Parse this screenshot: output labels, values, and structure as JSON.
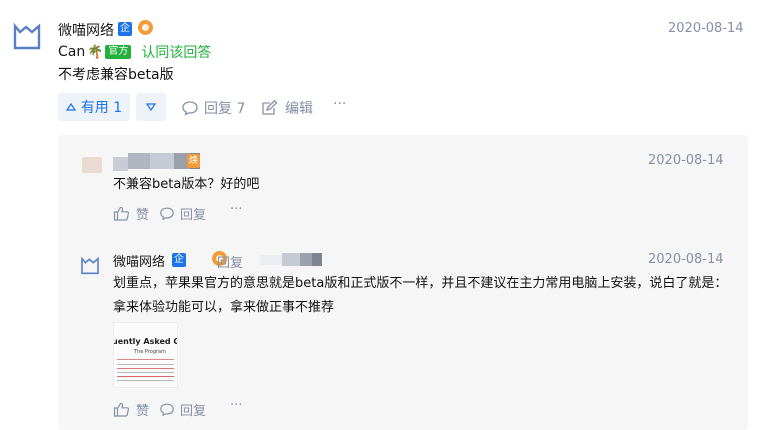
{
  "main_comment": {
    "author": "微喵网络",
    "qi_badge": "企",
    "date": "2020-08-14",
    "endorser_name": "Can",
    "official_tag": "官方",
    "endorse_text": "认同该回答",
    "content": "不考虑兼容beta版",
    "upvote_label": "有用 1",
    "reply_label": "回复 7",
    "edit_label": "编辑",
    "more_label": "···"
  },
  "replies": [
    {
      "date": "2020-08-14",
      "content": "不兼容beta版本？好的吧",
      "like_label": "赞",
      "reply_label": "回复",
      "more_label": "···",
      "tag": "焕"
    },
    {
      "author": "微喵网络",
      "qi_badge": "企",
      "reply_to_label": "回复",
      "date": "2020-08-14",
      "content": "划重点，苹果果官方的意思就是beta版和正式版不一样，并且不建议在主力常用电脑上安装，说白了就是：拿来体验功能可以，拿来做正事不推荐",
      "image_text_1": "uently Asked Quest",
      "image_text_2": "The Program",
      "like_label": "赞",
      "reply_label": "回复",
      "more_label": "···"
    }
  ],
  "colors": {
    "blue": "#1a73e8",
    "green": "#21b03a",
    "muted": "#8590a6",
    "orange": "#f29b38"
  }
}
